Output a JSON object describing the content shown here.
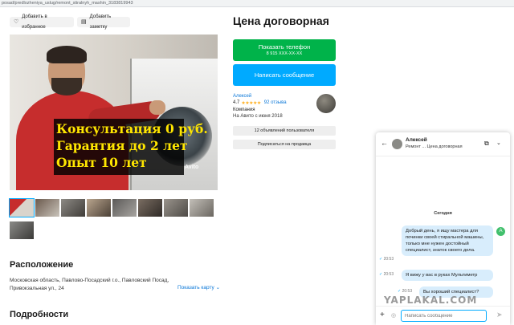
{
  "browser": {
    "url": "posad/predlozheniya_uslug/remont_stiralnyh_mashin_3183819943"
  },
  "actions": {
    "favorite_label": "Добавить в избранное",
    "note_label": "Добавить заметку"
  },
  "photo": {
    "overlay_lines": [
      "Консультация 0 руб.",
      "Гарантия до 2 лет",
      "Опыт 10 лет"
    ],
    "watermark": "Avito",
    "thumbnail_count": 9
  },
  "listing": {
    "price": "Цена договорная",
    "show_phone_label": "Показать телефон",
    "phone_masked": "8 915 XXX-XX-XX",
    "write_message_label": "Написать сообщение"
  },
  "seller": {
    "name": "Алексей",
    "rating": "4.7",
    "stars": "★★★★★",
    "reviews": "92 отзыва",
    "type": "Компания",
    "since": "На Авито с июня 2018",
    "listings_button": "12 объявлений пользователя",
    "subscribe_button": "Подписаться на продавца"
  },
  "location": {
    "heading": "Расположение",
    "address": "Московская область, Павлово-Посадский г.о., Павловский Посад, Привокзальная ул., 24",
    "show_map": "Показать карту"
  },
  "details": {
    "heading": "Подробности"
  },
  "chat": {
    "name": "Алексей",
    "subtitle": "Ремонт",
    "subtitle_price": "Цена договорная",
    "date_separator": "Сегодня",
    "avatar_letter": "А",
    "messages": [
      {
        "text": "Добрый день, я ищу мастера для починки своей стиральной машины, только мне нужен достойный специалист, знаток своего дела.",
        "time": "20:53"
      },
      {
        "text": "Я вижу у вас в руках Мультиметр",
        "time": "20:53"
      },
      {
        "text": "Вы хороший специалист?",
        "time": "20:53"
      }
    ],
    "input_placeholder": "Написать сообщение"
  },
  "site_watermark": "YAPLAKAL.COM"
}
